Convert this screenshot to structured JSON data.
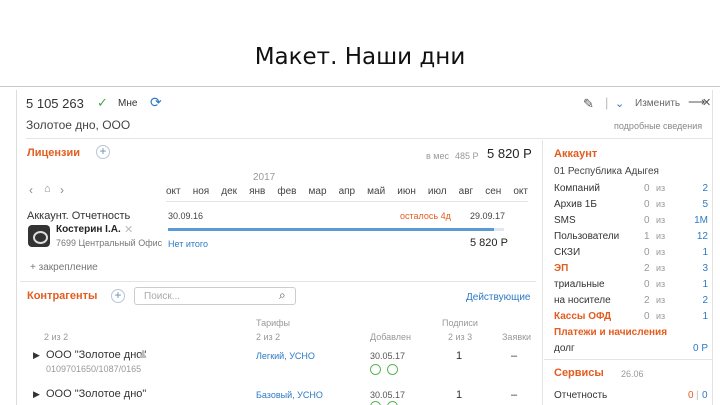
{
  "slide_title": "Макет. Наши дни",
  "header": {
    "client_id": "5 105 263",
    "user_label": "Мне",
    "client_name": "Золотое дно, ООО",
    "edit_label": "Изменить",
    "details_label": "подробные сведения"
  },
  "licenses": {
    "title": "Лицензии",
    "per_month_label": "в мес",
    "per_month_value": "485 Р",
    "total": "5 820 Р",
    "year": "2017",
    "months": [
      "окт",
      "ноя",
      "дек",
      "янв",
      "фев",
      "мар",
      "апр",
      "май",
      "июн",
      "июл",
      "авг",
      "сен",
      "окт"
    ],
    "item_name": "Аккаунт. Отчетность",
    "start_date": "30.09.16",
    "remaining": "осталось 4д",
    "end_date": "29.09.17",
    "manager_name": "Костерин I.A.",
    "manager_office": "7699 Центральный Офис",
    "not_paid_label": "Нет итого",
    "item_price": "5 820 Р",
    "progress": 0.97,
    "pin_label": "+ закрепление"
  },
  "contragents": {
    "title": "Контрагенты",
    "search_placeholder": "Поиск...",
    "filter_label": "Действующие",
    "count_label": "2 из 2",
    "col_tariffs": "Тарифы",
    "col_tariffs_sub": "2 из 2",
    "col_added": "Добавлен",
    "col_signatures": "Подписи",
    "col_signatures_sub": "2 из 3",
    "col_requests": "Заявки",
    "rows": [
      {
        "name": "ООО \"Золотое дно\"",
        "inn": "0109701650/1087/0165",
        "tariff": "Легкий, УСНО",
        "date": "30.05.17",
        "signs": "1",
        "req": "–"
      },
      {
        "name": "ООО \"Золотое дно\"",
        "inn": "",
        "tariff": "Базовый, УСНО",
        "date": "30.05.17",
        "signs": "1",
        "req": "–"
      }
    ]
  },
  "account": {
    "title": "Аккаунт",
    "region": "01 Республика Адыгея",
    "rows": [
      {
        "label": "Компаний",
        "val": "0",
        "of": "из",
        "max": "2"
      },
      {
        "label": "Архив 1Б",
        "val": "0",
        "of": "из",
        "max": "5"
      },
      {
        "label": "SMS",
        "val": "0",
        "of": "из",
        "max": "1М"
      },
      {
        "label": "Пользователи",
        "val": "1",
        "of": "из",
        "max": "12"
      },
      {
        "label": "СКЗИ",
        "val": "0",
        "of": "из",
        "max": "1"
      }
    ],
    "ep_title": "ЭП",
    "ep_rows": [
      {
        "label": "ЭП",
        "val": "2",
        "of": "из",
        "max": "3"
      },
      {
        "label": "триальные",
        "val": "0",
        "of": "из",
        "max": "1"
      },
      {
        "label": "на носителе",
        "val": "2",
        "of": "из",
        "max": "2"
      }
    ],
    "kkt_title": "Кассы ОФД",
    "kkt_val": "0",
    "kkt_of": "из",
    "kkt_max": "1",
    "payments_title": "Платежи и начисления",
    "debt_label": "долг",
    "debt_value": "0 Р",
    "services_title": "Сервисы",
    "services_date": "26.06",
    "reporting_label": "Отчетность",
    "reporting_val": "0",
    "reporting_max": "0"
  }
}
